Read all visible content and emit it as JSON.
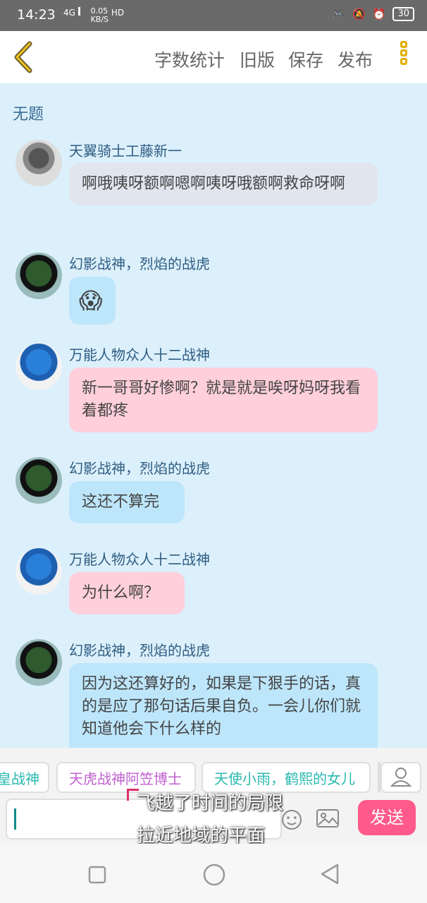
{
  "status": {
    "time": "14:23",
    "network": "4G",
    "speed_value": "0.05",
    "speed_unit": "KB/S",
    "hd": "HD",
    "battery": "30"
  },
  "toolbar": {
    "back_icon": "chevron-left-icon",
    "items": [
      "字数统计",
      "旧版",
      "保存",
      "发布"
    ],
    "more_icon": "more-vertical-icon"
  },
  "chat": {
    "doc_title": "无题",
    "messages": [
      {
        "name": "天翼骑士工藤新一",
        "text": "啊哦咦呀额啊嗯啊咦呀哦额啊救命呀啊",
        "bubble_color": "#e1e5ee"
      },
      {
        "name": "幻影战神，烈焰的战虎",
        "text": "😱",
        "bubble_color": "#bde6fb"
      },
      {
        "name": "万能人物众人十二战神",
        "text": "新一哥哥好惨啊？就是就是唉呀妈呀我看着都疼",
        "bubble_color": "#ffcfdc"
      },
      {
        "name": "幻影战神，烈焰的战虎",
        "text": "这还不算完",
        "bubble_color": "#bde6fb"
      },
      {
        "name": "万能人物众人十二战神",
        "text": "为什么啊？",
        "bubble_color": "#ffcfdc"
      },
      {
        "name": "幻影战神，烈焰的战虎",
        "text": "因为这还算好的，如果是下狠手的话，真的是应了那句话后果自负。一会儿你们就知道他会下什么样的",
        "bubble_color": "#bde6fb"
      }
    ]
  },
  "characters": {
    "chips": [
      "皇战神",
      "天虎战神阿笠博士",
      "天使小雨，鹤熙的女儿"
    ],
    "chip_colors": [
      "#2ab9b0",
      "#c060d0",
      "#2ab9b0"
    ],
    "person_icon": "person-icon"
  },
  "composer": {
    "input_value": "",
    "emoji_icon": "emoji-icon",
    "image_icon": "image-icon",
    "send_label": "发送"
  },
  "subtitle": {
    "line1": "飞越了时间的局限",
    "line2": "拉近地域的平面"
  },
  "navbar": {
    "icons": [
      "square-icon",
      "circle-icon",
      "triangle-back-icon"
    ]
  }
}
